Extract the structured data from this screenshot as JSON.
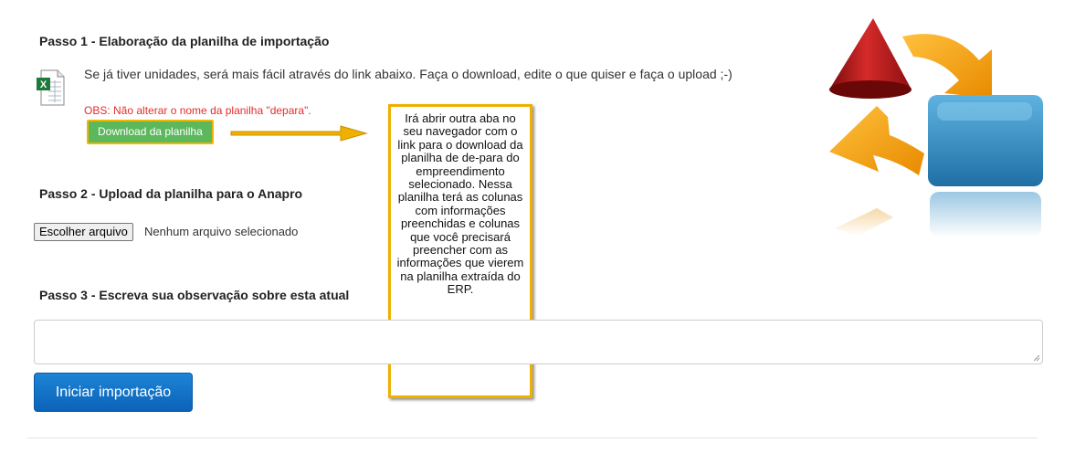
{
  "step1": {
    "title": "Passo 1 - Elaboração da planilha de importação",
    "description": "Se já tiver unidades, será mais fácil através do link abaixo. Faça o download, edite o que quiser e faça o upload ;-)",
    "obs": "OBS: Não alterar o nome da planilha \"depara\".",
    "download_label": "Download da planilha",
    "icon": "excel-file-icon"
  },
  "callout": {
    "text": "Irá abrir outra aba no seu navegador com o link para o download da planilha de de-para do empreendimento selecionado. Nessa planilha terá as colunas com informações preenchidas e colunas que você precisará preencher com as informações que vierem na planilha extraída do ERP."
  },
  "step2": {
    "title": "Passo 2 - Upload da planilha para o Anapro",
    "file_button": "Escolher arquivo",
    "file_status": "Nenhum arquivo selecionado"
  },
  "step3": {
    "title": "Passo 3 - Escreva sua observação sobre esta atual",
    "textarea_value": ""
  },
  "actions": {
    "start_label": "Iniciar importação"
  },
  "colors": {
    "download_button": "#5cb85c",
    "highlight_border": "#f0b000",
    "start_button": "#0b63b8",
    "obs_text": "#e52b2b"
  },
  "graphic": {
    "icon": "sync-exchange-icon"
  }
}
